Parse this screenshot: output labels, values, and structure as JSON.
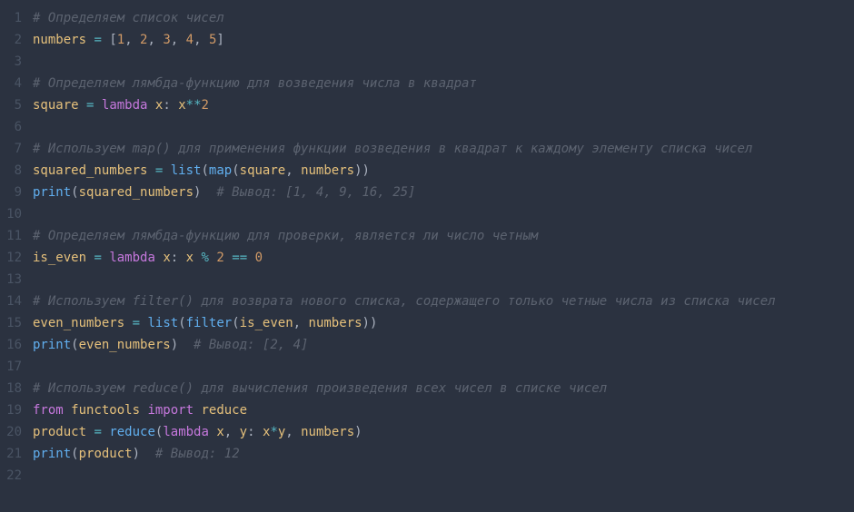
{
  "code": {
    "lines": [
      {
        "n": 1,
        "tokens": [
          {
            "cls": "comment",
            "t": "# Определяем список чисел"
          }
        ]
      },
      {
        "n": 2,
        "tokens": [
          {
            "cls": "ident",
            "t": "numbers"
          },
          {
            "cls": "punct",
            "t": " "
          },
          {
            "cls": "op",
            "t": "="
          },
          {
            "cls": "punct",
            "t": " ["
          },
          {
            "cls": "num",
            "t": "1"
          },
          {
            "cls": "punct",
            "t": ", "
          },
          {
            "cls": "num",
            "t": "2"
          },
          {
            "cls": "punct",
            "t": ", "
          },
          {
            "cls": "num",
            "t": "3"
          },
          {
            "cls": "punct",
            "t": ", "
          },
          {
            "cls": "num",
            "t": "4"
          },
          {
            "cls": "punct",
            "t": ", "
          },
          {
            "cls": "num",
            "t": "5"
          },
          {
            "cls": "punct",
            "t": "]"
          }
        ]
      },
      {
        "n": 3,
        "tokens": []
      },
      {
        "n": 4,
        "tokens": [
          {
            "cls": "comment",
            "t": "# Определяем лямбда-функцию для возведения числа в квадрат"
          }
        ]
      },
      {
        "n": 5,
        "tokens": [
          {
            "cls": "ident",
            "t": "square"
          },
          {
            "cls": "punct",
            "t": " "
          },
          {
            "cls": "op",
            "t": "="
          },
          {
            "cls": "punct",
            "t": " "
          },
          {
            "cls": "kw",
            "t": "lambda"
          },
          {
            "cls": "punct",
            "t": " "
          },
          {
            "cls": "ident",
            "t": "x"
          },
          {
            "cls": "punct",
            "t": ": "
          },
          {
            "cls": "ident",
            "t": "x"
          },
          {
            "cls": "op",
            "t": "**"
          },
          {
            "cls": "num",
            "t": "2"
          }
        ]
      },
      {
        "n": 6,
        "tokens": []
      },
      {
        "n": 7,
        "tokens": [
          {
            "cls": "comment",
            "t": "# Используем map() для применения функции возведения в квадрат к каждому элементу списка чисел"
          }
        ]
      },
      {
        "n": 8,
        "tokens": [
          {
            "cls": "ident",
            "t": "squared_numbers"
          },
          {
            "cls": "punct",
            "t": " "
          },
          {
            "cls": "op",
            "t": "="
          },
          {
            "cls": "punct",
            "t": " "
          },
          {
            "cls": "func",
            "t": "list"
          },
          {
            "cls": "punct",
            "t": "("
          },
          {
            "cls": "func",
            "t": "map"
          },
          {
            "cls": "punct",
            "t": "("
          },
          {
            "cls": "ident",
            "t": "square"
          },
          {
            "cls": "punct",
            "t": ", "
          },
          {
            "cls": "ident",
            "t": "numbers"
          },
          {
            "cls": "punct",
            "t": "))"
          }
        ]
      },
      {
        "n": 9,
        "tokens": [
          {
            "cls": "func",
            "t": "print"
          },
          {
            "cls": "punct",
            "t": "("
          },
          {
            "cls": "ident",
            "t": "squared_numbers"
          },
          {
            "cls": "punct",
            "t": ")  "
          },
          {
            "cls": "comment",
            "t": "# Вывод: [1, 4, 9, 16, 25]"
          }
        ]
      },
      {
        "n": 10,
        "tokens": []
      },
      {
        "n": 11,
        "tokens": [
          {
            "cls": "comment",
            "t": "# Определяем лямбда-функцию для проверки, является ли число четным"
          }
        ]
      },
      {
        "n": 12,
        "tokens": [
          {
            "cls": "ident",
            "t": "is_even"
          },
          {
            "cls": "punct",
            "t": " "
          },
          {
            "cls": "op",
            "t": "="
          },
          {
            "cls": "punct",
            "t": " "
          },
          {
            "cls": "kw",
            "t": "lambda"
          },
          {
            "cls": "punct",
            "t": " "
          },
          {
            "cls": "ident",
            "t": "x"
          },
          {
            "cls": "punct",
            "t": ": "
          },
          {
            "cls": "ident",
            "t": "x"
          },
          {
            "cls": "punct",
            "t": " "
          },
          {
            "cls": "op",
            "t": "%"
          },
          {
            "cls": "punct",
            "t": " "
          },
          {
            "cls": "num",
            "t": "2"
          },
          {
            "cls": "punct",
            "t": " "
          },
          {
            "cls": "op",
            "t": "=="
          },
          {
            "cls": "punct",
            "t": " "
          },
          {
            "cls": "num",
            "t": "0"
          }
        ]
      },
      {
        "n": 13,
        "tokens": []
      },
      {
        "n": 14,
        "tokens": [
          {
            "cls": "comment",
            "t": "# Используем filter() для возврата нового списка, содержащего только четные числа из списка чисел"
          }
        ]
      },
      {
        "n": 15,
        "tokens": [
          {
            "cls": "ident",
            "t": "even_numbers"
          },
          {
            "cls": "punct",
            "t": " "
          },
          {
            "cls": "op",
            "t": "="
          },
          {
            "cls": "punct",
            "t": " "
          },
          {
            "cls": "func",
            "t": "list"
          },
          {
            "cls": "punct",
            "t": "("
          },
          {
            "cls": "func",
            "t": "filter"
          },
          {
            "cls": "punct",
            "t": "("
          },
          {
            "cls": "ident",
            "t": "is_even"
          },
          {
            "cls": "punct",
            "t": ", "
          },
          {
            "cls": "ident",
            "t": "numbers"
          },
          {
            "cls": "punct",
            "t": "))"
          }
        ]
      },
      {
        "n": 16,
        "tokens": [
          {
            "cls": "func",
            "t": "print"
          },
          {
            "cls": "punct",
            "t": "("
          },
          {
            "cls": "ident",
            "t": "even_numbers"
          },
          {
            "cls": "punct",
            "t": ")  "
          },
          {
            "cls": "comment",
            "t": "# Вывод: [2, 4]"
          }
        ]
      },
      {
        "n": 17,
        "tokens": []
      },
      {
        "n": 18,
        "tokens": [
          {
            "cls": "comment",
            "t": "# Используем reduce() для вычисления произведения всех чисел в списке чисел"
          }
        ]
      },
      {
        "n": 19,
        "tokens": [
          {
            "cls": "kw",
            "t": "from"
          },
          {
            "cls": "punct",
            "t": " "
          },
          {
            "cls": "ident",
            "t": "functools"
          },
          {
            "cls": "punct",
            "t": " "
          },
          {
            "cls": "kw",
            "t": "import"
          },
          {
            "cls": "punct",
            "t": " "
          },
          {
            "cls": "ident",
            "t": "reduce"
          }
        ]
      },
      {
        "n": 20,
        "tokens": [
          {
            "cls": "ident",
            "t": "product"
          },
          {
            "cls": "punct",
            "t": " "
          },
          {
            "cls": "op",
            "t": "="
          },
          {
            "cls": "punct",
            "t": " "
          },
          {
            "cls": "func",
            "t": "reduce"
          },
          {
            "cls": "punct",
            "t": "("
          },
          {
            "cls": "kw",
            "t": "lambda"
          },
          {
            "cls": "punct",
            "t": " "
          },
          {
            "cls": "ident",
            "t": "x"
          },
          {
            "cls": "punct",
            "t": ", "
          },
          {
            "cls": "ident",
            "t": "y"
          },
          {
            "cls": "punct",
            "t": ": "
          },
          {
            "cls": "ident",
            "t": "x"
          },
          {
            "cls": "op",
            "t": "*"
          },
          {
            "cls": "ident",
            "t": "y"
          },
          {
            "cls": "punct",
            "t": ", "
          },
          {
            "cls": "ident",
            "t": "numbers"
          },
          {
            "cls": "punct",
            "t": ")"
          }
        ]
      },
      {
        "n": 21,
        "tokens": [
          {
            "cls": "func",
            "t": "print"
          },
          {
            "cls": "punct",
            "t": "("
          },
          {
            "cls": "ident",
            "t": "product"
          },
          {
            "cls": "punct",
            "t": ")  "
          },
          {
            "cls": "comment",
            "t": "# Вывод: 12"
          }
        ]
      },
      {
        "n": 22,
        "tokens": []
      }
    ]
  }
}
